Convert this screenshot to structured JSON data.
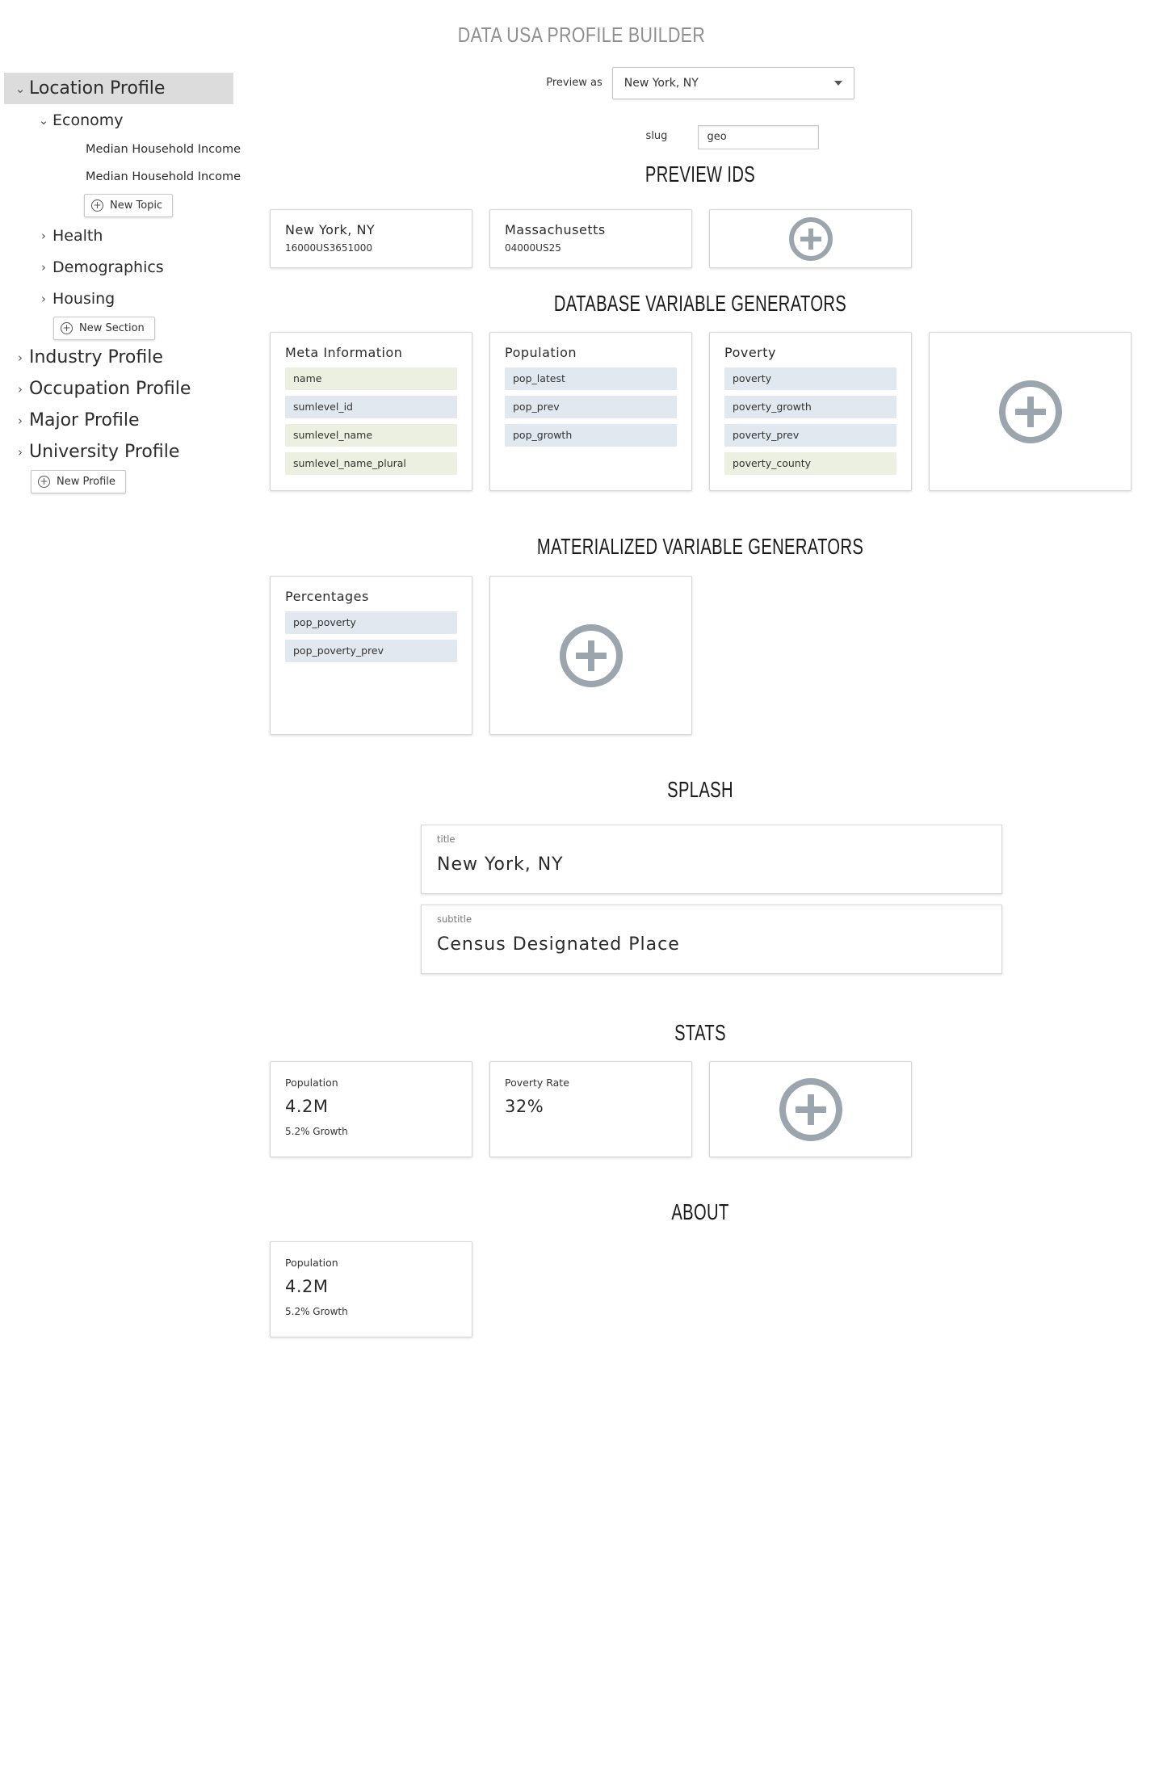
{
  "app_title": "DATA USA PROFILE BUILDER",
  "sidebar": {
    "profiles": [
      {
        "label": "Location Profile",
        "expanded": true,
        "selected": true
      },
      {
        "label": "Industry Profile",
        "expanded": false
      },
      {
        "label": "Occupation Profile",
        "expanded": false
      },
      {
        "label": "Major Profile",
        "expanded": false
      },
      {
        "label": "University Profile",
        "expanded": false
      }
    ],
    "sections": [
      {
        "label": "Economy",
        "expanded": true
      },
      {
        "label": "Health",
        "expanded": false
      },
      {
        "label": "Demographics",
        "expanded": false
      },
      {
        "label": "Housing",
        "expanded": false
      }
    ],
    "topics": [
      "Median Household Income",
      "Median Household Income"
    ],
    "new_topic": "New Topic",
    "new_section": "New Section",
    "new_profile": "New Profile"
  },
  "preview": {
    "label": "Preview as",
    "selected": "New York, NY"
  },
  "slug": {
    "label": "slug",
    "value": "geo"
  },
  "preview_ids": {
    "title": "PREVIEW IDS",
    "items": [
      {
        "name": "New York, NY",
        "id": "16000US3651000"
      },
      {
        "name": "Massachusetts",
        "id": "04000US25"
      }
    ]
  },
  "db_generators": {
    "title": "DATABASE VARIABLE GENERATORS",
    "cards": [
      {
        "title": "Meta Information",
        "vars": [
          "name",
          "sumlevel_id",
          "sumlevel_name",
          "sumlevel_name_plural"
        ],
        "colors": [
          "green",
          "blue",
          "green",
          "green"
        ]
      },
      {
        "title": "Population",
        "vars": [
          "pop_latest",
          "pop_prev",
          "pop_growth"
        ],
        "colors": [
          "blue",
          "blue",
          "blue"
        ]
      },
      {
        "title": "Poverty",
        "vars": [
          "poverty",
          "poverty_growth",
          "poverty_prev",
          "poverty_county"
        ],
        "colors": [
          "blue",
          "blue",
          "blue",
          "green"
        ]
      }
    ]
  },
  "mat_generators": {
    "title": "MATERIALIZED VARIABLE GENERATORS",
    "cards": [
      {
        "title": "Percentages",
        "vars": [
          "pop_poverty",
          "pop_poverty_prev"
        ],
        "colors": [
          "blue",
          "blue"
        ]
      }
    ]
  },
  "splash": {
    "title": "SPLASH",
    "fields": [
      {
        "label": "title",
        "value": "New York, NY"
      },
      {
        "label": "subtitle",
        "value": "Census Designated Place"
      }
    ]
  },
  "stats": {
    "title": "STATS",
    "items": [
      {
        "label": "Population",
        "value": "4.2M",
        "sub": "5.2% Growth"
      },
      {
        "label": "Poverty Rate",
        "value": "32%",
        "sub": ""
      }
    ]
  },
  "about": {
    "title": "ABOUT",
    "items": [
      {
        "label": "Population",
        "value": "4.2M",
        "sub": "5.2% Growth"
      }
    ]
  },
  "colors": {
    "var_blue": "#e2e8ef",
    "var_green": "#ebf0e1",
    "plus_icon": "#9aa5ad",
    "selected_bg": "#dcdcdc"
  }
}
